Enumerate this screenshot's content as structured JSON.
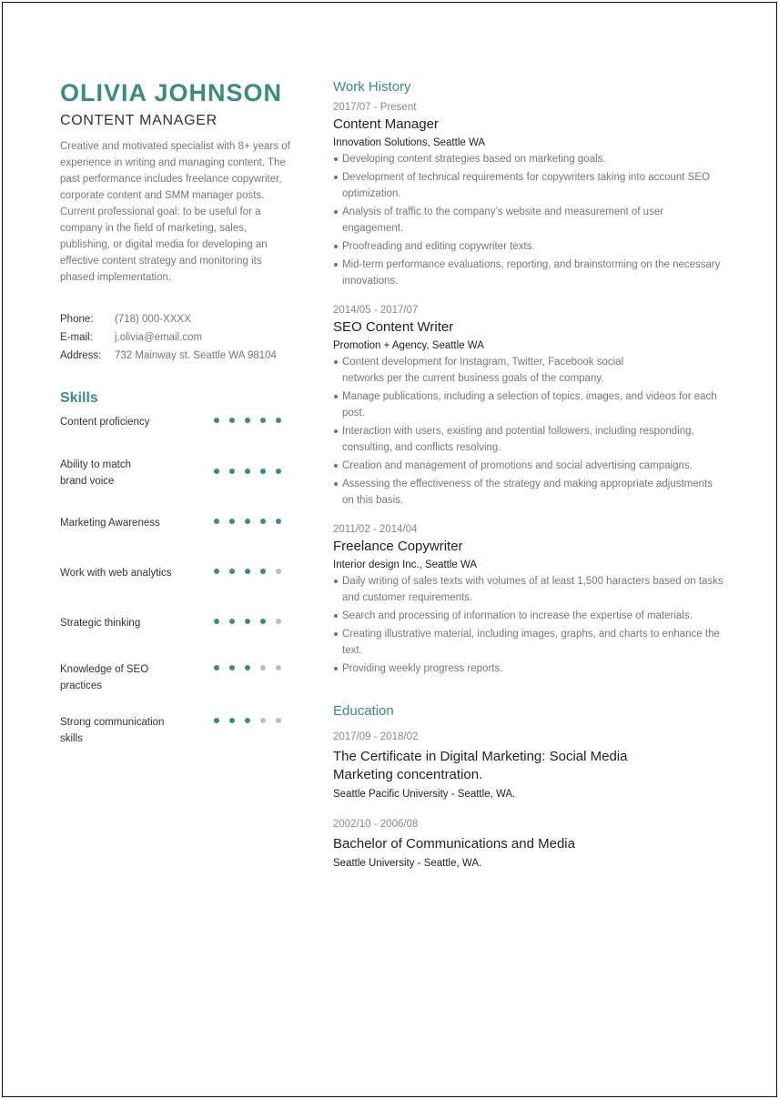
{
  "header": {
    "name": "OLIVIA JOHNSON",
    "role": "CONTENT MANAGER",
    "summary": "Creative and motivated specialist with 8+ years of experience in writing and managing content. The past performance includes freelance copywriter, corporate content and SMM manager posts. Current professional goal: to be useful for a company in the field of marketing, sales, publishing, or digital media for developing an effective content strategy and monitoring its phased implementation."
  },
  "contacts": [
    {
      "label": "Phone:",
      "value": "(718) 000-XXXX"
    },
    {
      "label": "E-mail:",
      "value": "j.olivia@email.com"
    },
    {
      "label": "Address:",
      "value": "732 Mainway st. Seattle WA 98104"
    }
  ],
  "skills": {
    "title": "Skills",
    "max_level": 5,
    "items": [
      {
        "label": "Content proficiency",
        "level": 5
      },
      {
        "label": "Ability to match brand voice",
        "level": 5
      },
      {
        "label": "Marketing Awareness",
        "level": 5
      },
      {
        "label": "Work with web analytics",
        "level": 4
      },
      {
        "label": "Strategic thinking",
        "level": 4
      },
      {
        "label": "Knowledge of SEO practices",
        "level": 3
      },
      {
        "label": "Strong communication skills",
        "level": 3
      }
    ]
  },
  "work_history": {
    "title": "Work History",
    "jobs": [
      {
        "dates": "2017/07 - Present",
        "title": "Content Manager",
        "company": "Innovation Solutions, Seattle WA",
        "bullets": [
          "Developing content strategies based on marketing goals.",
          "Development of technical requirements for copywriters taking into account SEO optimization.",
          "Analysis of traffic to the company’s website and measurement of user engagement.",
          "Proofreading and editing copywriter texts.",
          "Mid-term performance evaluations, reporting, and brainstorming on the necessary innovations."
        ]
      },
      {
        "dates": "2014/05 - 2017/07",
        "title": "SEO Content Writer",
        "company": "Promotion + Agency, Seattle WA",
        "bullets": [
          "Content development for Instagram, Twitter, Facebook social networks per the current business goals of the company.",
          "Manage publications, including a selection of topics, images, and videos for each post.",
          "Interaction with users, existing and potential followers, including responding, consulting, and conflicts resolving.",
          "Creation and management of promotions and social advertising campaigns.",
          "Assessing the effectiveness of the strategy and making appropriate adjustments on this basis."
        ]
      },
      {
        "dates": "2011/02 - 2014/04",
        "title": "Freelance Copywriter",
        "company": "Interior design Inc., Seattle WA",
        "bullets": [
          "Daily writing of sales texts with volumes of at least 1,500 haracters based on tasks and customer requirements.",
          "Search and processing of information to increase the expertise of materials.",
          "Creating illustrative material, including images, graphs, and charts to enhance the text.",
          "Providing weekly progress reports."
        ]
      }
    ]
  },
  "education": {
    "title": "Education",
    "items": [
      {
        "dates": "2017/09 - 2018/02",
        "title": "The Certificate in Digital Marketing: Social Media Marketing concentration.",
        "school": "Seattle Pacific University - Seattle, WA."
      },
      {
        "dates": "2002/10 - 2006/08",
        "title": "Bachelor of Communications and Media",
        "school": "Seattle University - Seattle, WA."
      }
    ]
  },
  "colors": {
    "accent": "#3a8c82",
    "dot_inactive": "#bcbdc2",
    "text_dark": "#333333",
    "text_muted": "#777777"
  }
}
